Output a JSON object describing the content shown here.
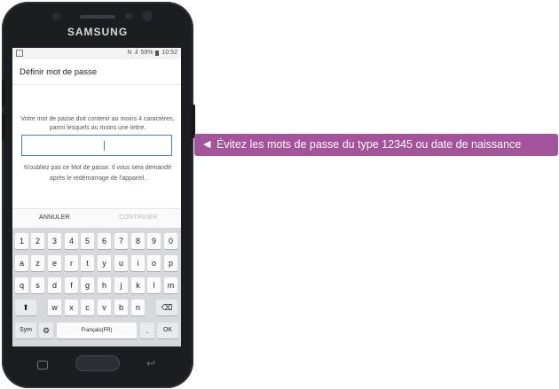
{
  "brand": "SAMSUNG",
  "status_bar": {
    "signal": "N .il",
    "battery": "59%",
    "time": "10:52"
  },
  "screen": {
    "title": "Définir mot de passe",
    "description": "Votre mot de passe doit contenir au moins 4 caractères, parmi lesquels au moins une lettre.",
    "hint": "N'oubliez pas ce Mot de passe. Il vous sera demandé après le redémarrage de l'appareil.",
    "password_value": "",
    "cancel_label": "ANNULER",
    "continue_label": "CONTINUER"
  },
  "keyboard": {
    "row1": [
      "1",
      "2",
      "3",
      "4",
      "5",
      "6",
      "7",
      "8",
      "9",
      "0"
    ],
    "row2": [
      "a",
      "z",
      "e",
      "r",
      "t",
      "y",
      "u",
      "i",
      "o",
      "p"
    ],
    "row3": [
      "q",
      "s",
      "d",
      "f",
      "g",
      "h",
      "j",
      "k",
      "l",
      "m"
    ],
    "row4": [
      "w",
      "x",
      "c",
      "v",
      "b",
      "n"
    ],
    "shift": "⬆",
    "backspace": "⌫",
    "sym": "Sym",
    "settings": "⚙",
    "space": "Français(FR)",
    "period": ".",
    "ok": "OK"
  },
  "callout": {
    "arrow": "◀",
    "text": "Évitez les mots de passe du type 12345 ou date de naissance",
    "color": "#a4539b"
  }
}
